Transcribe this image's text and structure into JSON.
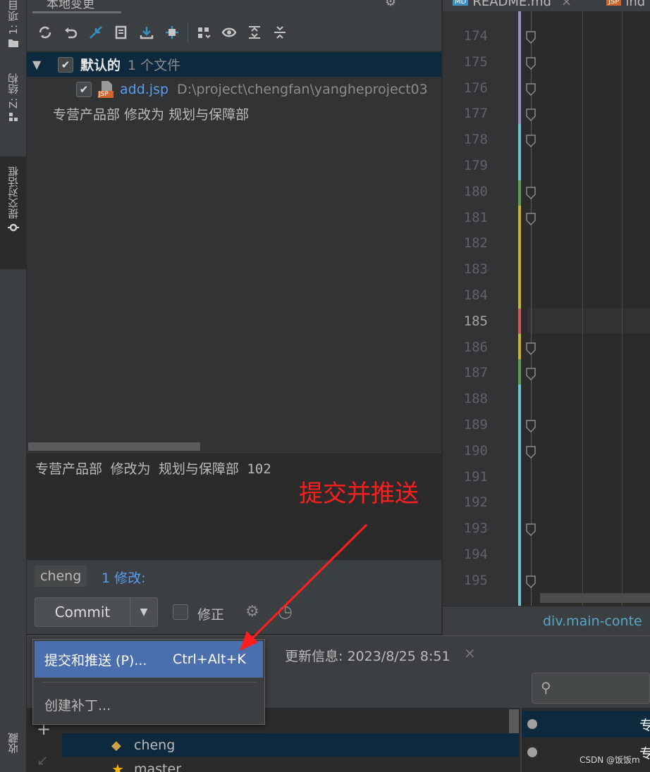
{
  "side_tabs": {
    "project": "1: 项目",
    "structure": "Z: 结构",
    "commit_dialog": "提交对话框",
    "favorites": "收藏"
  },
  "commit_panel": {
    "title": "本地变更",
    "changelist": {
      "name": "默认的",
      "count": "1 个文件",
      "checked": true
    },
    "file": {
      "name": "add.jsp",
      "path": "D:\\project\\chengfan\\yangheproject03",
      "type_badge": "JSP"
    },
    "tree_message": "专营产品部 修改为 规划与保障部",
    "commit_message": "专营产品部 修改为 规划与保障部 102",
    "annotation": "提交并推送",
    "branch": "cheng",
    "changes_count": "1 修改:",
    "commit_button": "Commit",
    "amend_label": "修正"
  },
  "editor": {
    "tabs": [
      {
        "badge": "MD",
        "label": "README.md",
        "badge_color": "#3d8fc6"
      },
      {
        "badge": "JSP",
        "label": "ind",
        "badge_color": "#d0662c"
      }
    ],
    "line_numbers": [
      "174",
      "175",
      "176",
      "177",
      "178",
      "179",
      "180",
      "181",
      "182",
      "183",
      "184",
      "185",
      "186",
      "187",
      "188",
      "189",
      "190",
      "191",
      "192",
      "193",
      "194",
      "195"
    ],
    "current_line": "185",
    "breadcrumb": "div.main-conte"
  },
  "popup_menu": {
    "items": [
      {
        "label": "提交和推送 (P)...",
        "shortcut": "Ctrl+Alt+K"
      },
      {
        "label": "创建补丁..."
      }
    ]
  },
  "git_panel": {
    "update_tab": "更新信息: 2023/8/25 8:51",
    "branches": [
      {
        "name": "cheng",
        "icon": "tag-icon"
      },
      {
        "name": "master",
        "icon": "star-icon"
      }
    ],
    "log_rows": [
      "专",
      "专"
    ]
  },
  "watermark": "CSDN @饭饭m",
  "colors": {
    "selection": "#0d293e",
    "popup_highlight": "#4b6eaf",
    "annotation": "#ff1e1e",
    "link_blue": "#589df6"
  }
}
